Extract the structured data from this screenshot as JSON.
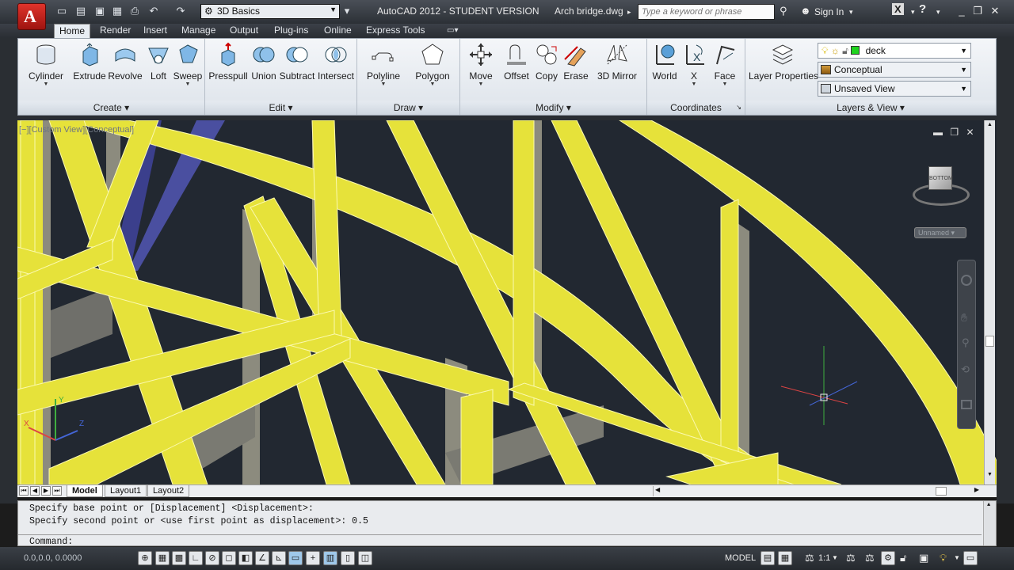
{
  "titlebar": {
    "logo_letter": "A",
    "workspace": "3D Basics",
    "app_title": "AutoCAD 2012 - STUDENT VERSION",
    "file_name": "Arch bridge.dwg",
    "search_placeholder": "Type a keyword or phrase",
    "signin_label": "Sign In"
  },
  "ribbon_tabs": [
    "Home",
    "Render",
    "Insert",
    "Manage",
    "Output",
    "Plug-ins",
    "Online",
    "Express Tools"
  ],
  "panels": {
    "create": {
      "title": "Create",
      "tools": [
        "Cylinder",
        "Extrude",
        "Revolve",
        "Loft",
        "Sweep"
      ]
    },
    "edit": {
      "title": "Edit",
      "tools": [
        "Presspull",
        "Union",
        "Subtract",
        "Intersect"
      ]
    },
    "draw": {
      "title": "Draw",
      "tools": [
        "Polyline",
        "Polygon"
      ]
    },
    "modify": {
      "title": "Modify",
      "tools": [
        "Move",
        "Offset",
        "Copy",
        "Erase",
        "3D Mirror"
      ]
    },
    "coordinates": {
      "title": "Coordinates",
      "tools": [
        "World",
        "X",
        "Face"
      ]
    },
    "layers": {
      "title": "Layers & View",
      "tool": "Layer Properties",
      "layer": "deck",
      "visual_style": "Conceptual",
      "view": "Unsaved View"
    }
  },
  "viewport": {
    "label": "[−][Custom View][Conceptual]",
    "ucs_label": "Unnamed",
    "viewcube_face": "BOTTOM"
  },
  "layout_tabs": [
    "Model",
    "Layout1",
    "Layout2"
  ],
  "command": {
    "history": [
      "Specify base point or [Displacement] <Displacement>:",
      "Specify second point or <use first point as displacement>: 0.5"
    ],
    "prompt": "Command:"
  },
  "statusbar": {
    "coords": "0.0,0.0, 0.0000",
    "model_label": "MODEL",
    "scale": "1:1"
  },
  "colors": {
    "beam": "#e6e23a",
    "beam_edge": "#fbf9b0",
    "beam_shadow": "#9a9878",
    "viewport_bg": "#222831",
    "logo": "#d42d24"
  }
}
